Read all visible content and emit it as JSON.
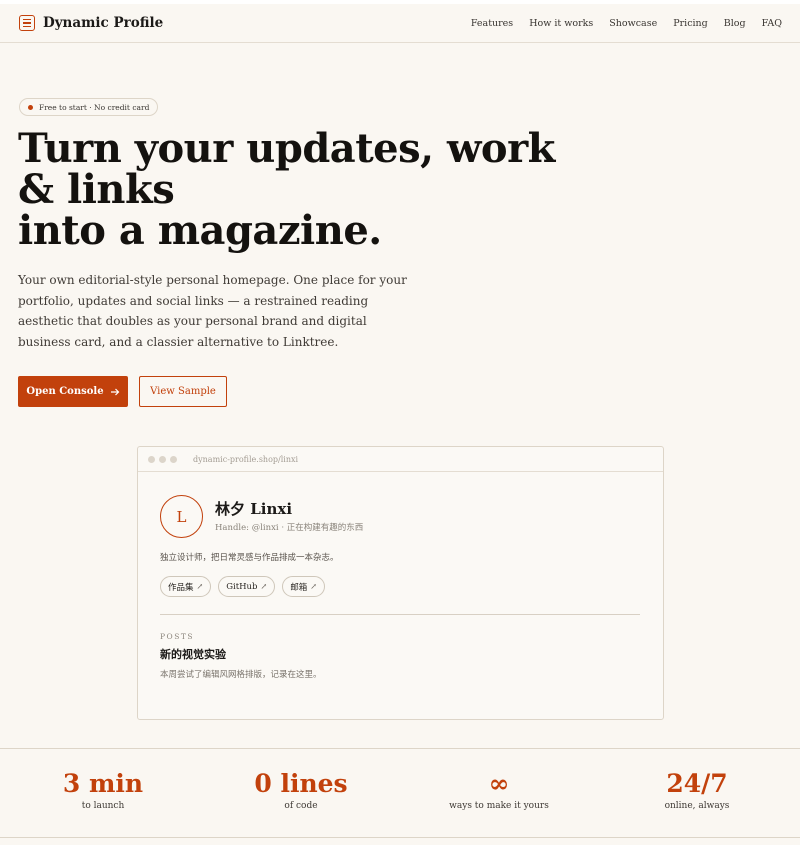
{
  "brand": {
    "name": "Dynamic Profile",
    "icon": "menu-lines-icon"
  },
  "nav": {
    "links": [
      "Features",
      "How it works",
      "Showcase",
      "Pricing",
      "Blog",
      "FAQ"
    ]
  },
  "hero": {
    "badge": "Free to start · No credit card",
    "title_lines": [
      "Turn your updates, work",
      "& links",
      "into a magazine."
    ],
    "description": "Your own editorial-style personal homepage. One place for your portfolio, updates and social links — a restrained reading aesthetic that doubles as your personal brand and digital business card, and a classier alternative to Linktree.",
    "primary_button": "Open Console",
    "primary_button_icon": "arrow-right-icon",
    "secondary_button": "View Sample"
  },
  "preview": {
    "url": "dynamic-profile.shop/linxi",
    "avatar_initial": "L",
    "name": "林夕 Linxi",
    "handle": "Handle: @linxi · 正在构建有趣的东西",
    "bio": "独立设计师，把日常灵感与作品排成一本杂志。",
    "links": [
      "作品集",
      "GitHub",
      "邮箱"
    ],
    "link_arrow": "↗",
    "section_label": "POSTS",
    "post_title": "新的视觉实验",
    "post_desc": "本周尝试了编辑风网格排版，记录在这里。"
  },
  "stats": [
    {
      "value": "3 min",
      "label": "to launch"
    },
    {
      "value": "0 lines",
      "label": "of code"
    },
    {
      "value": "∞",
      "label": "ways to make it yours"
    },
    {
      "value": "24/7",
      "label": "online, always"
    }
  ],
  "colors": {
    "accent": "#c2410c",
    "background": "#faf7f2",
    "text": "#1c1a18"
  }
}
